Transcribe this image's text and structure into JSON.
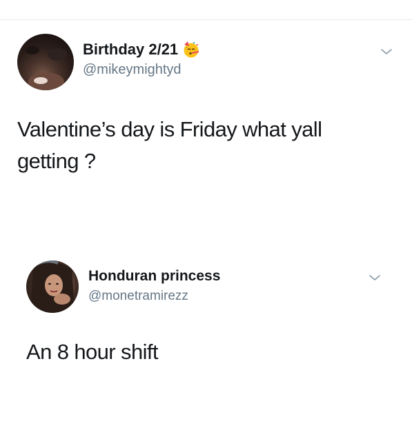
{
  "tweets": [
    {
      "display_name": "Birthday 2/21",
      "emoji_icon": "partying-face-emoji",
      "handle": "@mikeymightyd",
      "text": "Valentine’s day is Friday what yall getting ?"
    },
    {
      "display_name": "Honduran princess",
      "handle": "@monetramirezz",
      "text": "An 8 hour shift"
    }
  ],
  "colors": {
    "text": "#14171a",
    "secondary": "#657786",
    "divider": "#e6ecf0",
    "chevron": "#8899a6"
  }
}
